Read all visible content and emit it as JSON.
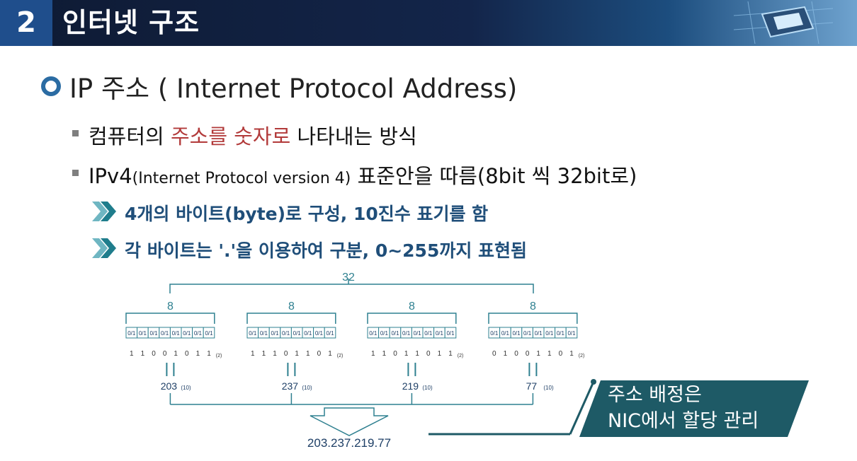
{
  "header": {
    "number": "2",
    "title": "인터넷 구조"
  },
  "section": {
    "title": "IP 주소 ( Internet Protocol Address)"
  },
  "bullets": {
    "b1_pre": "컴퓨터의 ",
    "b1_red": "주소를 숫자로",
    "b1_post": " 나타내는 방식",
    "b2_pre": "IPv4",
    "b2_small": "(Internet Protocol version 4)",
    "b2_post": " 표준안을 따름(8bit 씩 32bit로)"
  },
  "subbullets": [
    "4개의 바이트(byte)로 구성, 10진수 표기를 함",
    "각 바이트는 '.'을 이용하여 구분, 0~255까지 표현됨"
  ],
  "diagram": {
    "total_bits": "32",
    "byte_bits": "8",
    "cell_text": "0/1",
    "radix2": "(2)",
    "radix10": "(10)",
    "bytes": [
      {
        "bits": "1 1 0 0 1 0 1 1",
        "decimal": "203"
      },
      {
        "bits": "1 1 1 0 1 1 0 1",
        "decimal": "237"
      },
      {
        "bits": "1 1 0 1 1 0 1 1",
        "decimal": "219"
      },
      {
        "bits": "0 1 0 0 1 1 0 1",
        "decimal": "77"
      }
    ],
    "result": "203.237.219.77"
  },
  "callout": {
    "line1": "주소 배정은",
    "line2": "NIC에서 할당  관리"
  },
  "colors": {
    "header_dark": "#0e1a33",
    "header_num": "#1f4e8c",
    "accent_blue": "#2b6ca3",
    "highlight_red": "#b23a3a",
    "teal": "#3a8d9a",
    "callout": "#1e5a66",
    "diagram_line": "#2f8090"
  }
}
